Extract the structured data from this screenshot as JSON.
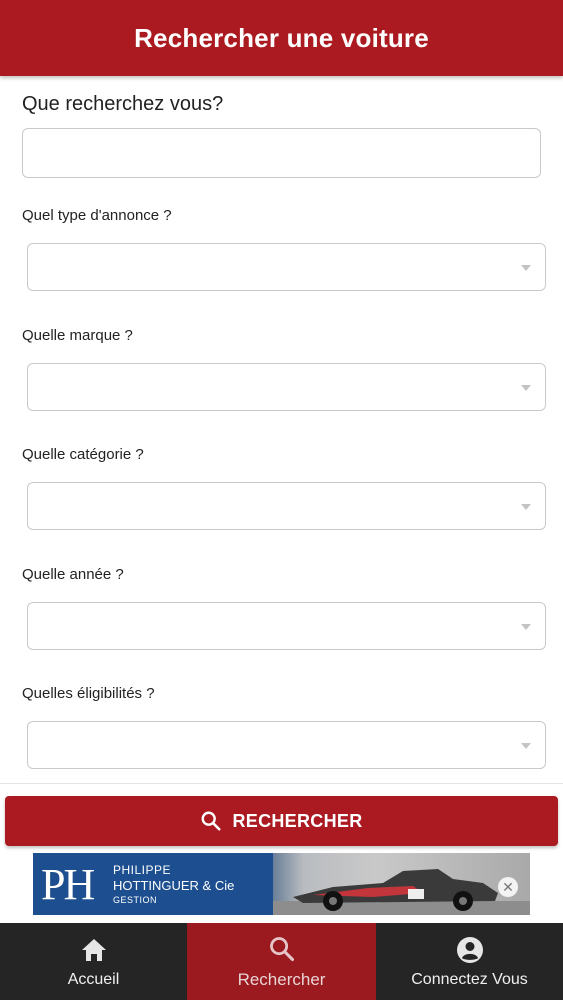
{
  "header": {
    "title": "Rechercher une voiture"
  },
  "search": {
    "question": "Que recherchez vous?",
    "value": "",
    "placeholder": ""
  },
  "fields": [
    {
      "label": "Quel type d'annonce ?",
      "value": ""
    },
    {
      "label": "Quelle marque ?",
      "value": ""
    },
    {
      "label": "Quelle catégorie ?",
      "value": ""
    },
    {
      "label": "Quelle année ?",
      "value": ""
    },
    {
      "label": "Quelles éligibilités ?",
      "value": ""
    }
  ],
  "search_button": {
    "label": "RECHERCHER",
    "icon": "search-icon"
  },
  "ad": {
    "logo": "PH",
    "line1": "PHILIPPE",
    "line2": "HOTTINGUER & Cie",
    "line3": "GESTION",
    "close": "✕"
  },
  "nav": {
    "items": [
      {
        "label": "Accueil",
        "icon": "home-icon",
        "active": false
      },
      {
        "label": "Rechercher",
        "icon": "search-icon",
        "active": true
      },
      {
        "label": "Connectez Vous",
        "icon": "account-icon",
        "active": false
      }
    ]
  },
  "colors": {
    "primary": "#ab1a21",
    "nav_bg": "#252525",
    "nav_active": "#9a1a1f",
    "ad_blue": "#1d4f90"
  }
}
